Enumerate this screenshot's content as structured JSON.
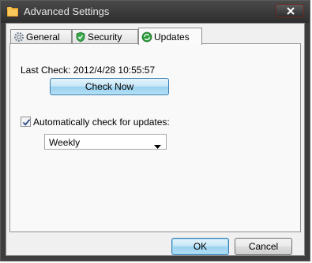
{
  "window": {
    "title": "Advanced Settings",
    "app_icon": "folder-icon",
    "close_icon": "close-icon"
  },
  "tabs": [
    {
      "label": "General",
      "icon": "gear-icon",
      "active": false
    },
    {
      "label": "Security",
      "icon": "shield-icon",
      "active": false
    },
    {
      "label": "Updates",
      "icon": "refresh-icon",
      "active": true
    }
  ],
  "updates": {
    "last_check_label": "Last Check: 2012/4/28 10:55:57",
    "check_now_label": "Check Now",
    "auto_check_label": "Automatically check for updates:",
    "auto_check_checked": true,
    "frequency_value": "Weekly"
  },
  "footer": {
    "ok_label": "OK",
    "cancel_label": "Cancel"
  },
  "colors": {
    "accent_border": "#3c7fb1",
    "button_blue": "#c4e5f6",
    "titlebar": "#2e2e2e"
  }
}
